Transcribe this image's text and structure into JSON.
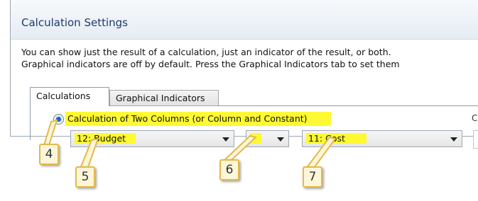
{
  "window": {
    "title": "Calculation Settings",
    "description_line1": "You can show just the result of a calculation, just an indicator of the result, or both.",
    "description_line2": "Graphical indicators are off by default. Press the Graphical Indicators tab to set them"
  },
  "tabs": [
    {
      "label": "Calculations",
      "active": true
    },
    {
      "label": "Graphical Indicators",
      "active": false
    }
  ],
  "calculation": {
    "option_label": "Calculation of Two Columns (or Column and Constant)",
    "selected": true,
    "cut_off_label": "C",
    "first_column": "12: Budget",
    "operator": "-",
    "second_column": "11: Cost"
  },
  "callouts": [
    "4",
    "5",
    "6",
    "7"
  ],
  "colors": {
    "highlight": "#fff933",
    "callout_border": "#e3b94a",
    "callout_fill": "#fdf6d9",
    "title_text": "#1e3a6e"
  }
}
